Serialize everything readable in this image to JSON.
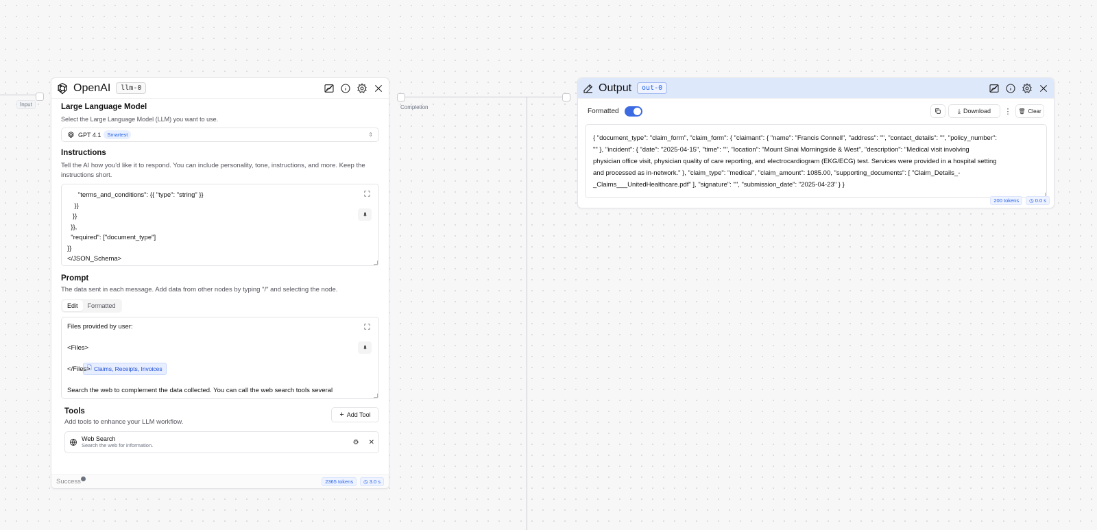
{
  "canvas": {
    "port_input_label": "Input",
    "port_completion_label": "Completion"
  },
  "llm_node": {
    "title": "OpenAI",
    "id": "llm-0",
    "model_section": {
      "title": "Large Language Model",
      "description": "Select the Large Language Model (LLM) you want to use.",
      "selected_model": "GPT 4.1",
      "model_badge": "Smartest"
    },
    "instructions_section": {
      "title": "Instructions",
      "description": "Tell the AI how you'd like it to respond. You can include personality, tone, instructions, and more. Keep the instructions short.",
      "lines": [
        "      \"terms_and_conditions\": {{ \"type\": \"string\" }}",
        "    }}",
        "   }}",
        "  }},",
        "  \"required\": [\"document_type\"]",
        "}}",
        "</JSON_Schema>"
      ]
    },
    "prompt_section": {
      "title": "Prompt",
      "description": "The data sent in each message. Add data from other nodes by typing \"/\" and selecting the node.",
      "tab_edit": "Edit",
      "tab_formatted": "Formatted",
      "line1": "Files provided by user:",
      "line2": "<Files>",
      "chip_label": "Claims, Receipts, Invoices",
      "line3": "</Files>",
      "line4": "Search the web to complement the data collected. You can call the web search tools several"
    },
    "tools_section": {
      "title": "Tools",
      "description": "Add tools to enhance your LLM workflow.",
      "add_tool_label": "Add Tool",
      "tools": [
        {
          "name": "Web Search",
          "description": "Search the web for information."
        }
      ]
    },
    "footer": {
      "status": "Success",
      "tokens": "2365 tokens",
      "time": "3.0 s"
    }
  },
  "output_node": {
    "title": "Output",
    "id": "out-0",
    "formatted_label": "Formatted",
    "formatted_on": true,
    "download_label": "Download",
    "clear_label": "Clear",
    "content_lines": [
      "{ \"document_type\": \"claim_form\", \"claim_form\": { \"claimant\": { \"name\": \"Francis Connell\", \"address\": \"\", \"contact_details\": \"\", \"policy_number\":",
      "\"\" }, \"incident\": { \"date\": \"2025-04-15\", \"time\": \"\", \"location\": \"Mount Sinai Morningside & West\", \"description\": \"Medical visit involving",
      "physician office visit, physician quality of care reporting, and electrocardiogram (EKG/ECG) test. Services were provided in a hospital setting",
      "and processed as in-network.\" }, \"claim_type\": \"medical\", \"claim_amount\": 1085.00, \"supporting_documents\": [ \"Claim_Details_-",
      "_Claims___UnitedHealthcare.pdf\" ], \"signature\": \"\", \"submission_date\": \"2025-04-23\" } }"
    ],
    "footer": {
      "tokens": "200 tokens",
      "time": "0.0 s"
    }
  },
  "colors": {
    "accent": "#3b6ae3",
    "output_header": "#dde8fb",
    "badge_text": "#2563eb"
  }
}
